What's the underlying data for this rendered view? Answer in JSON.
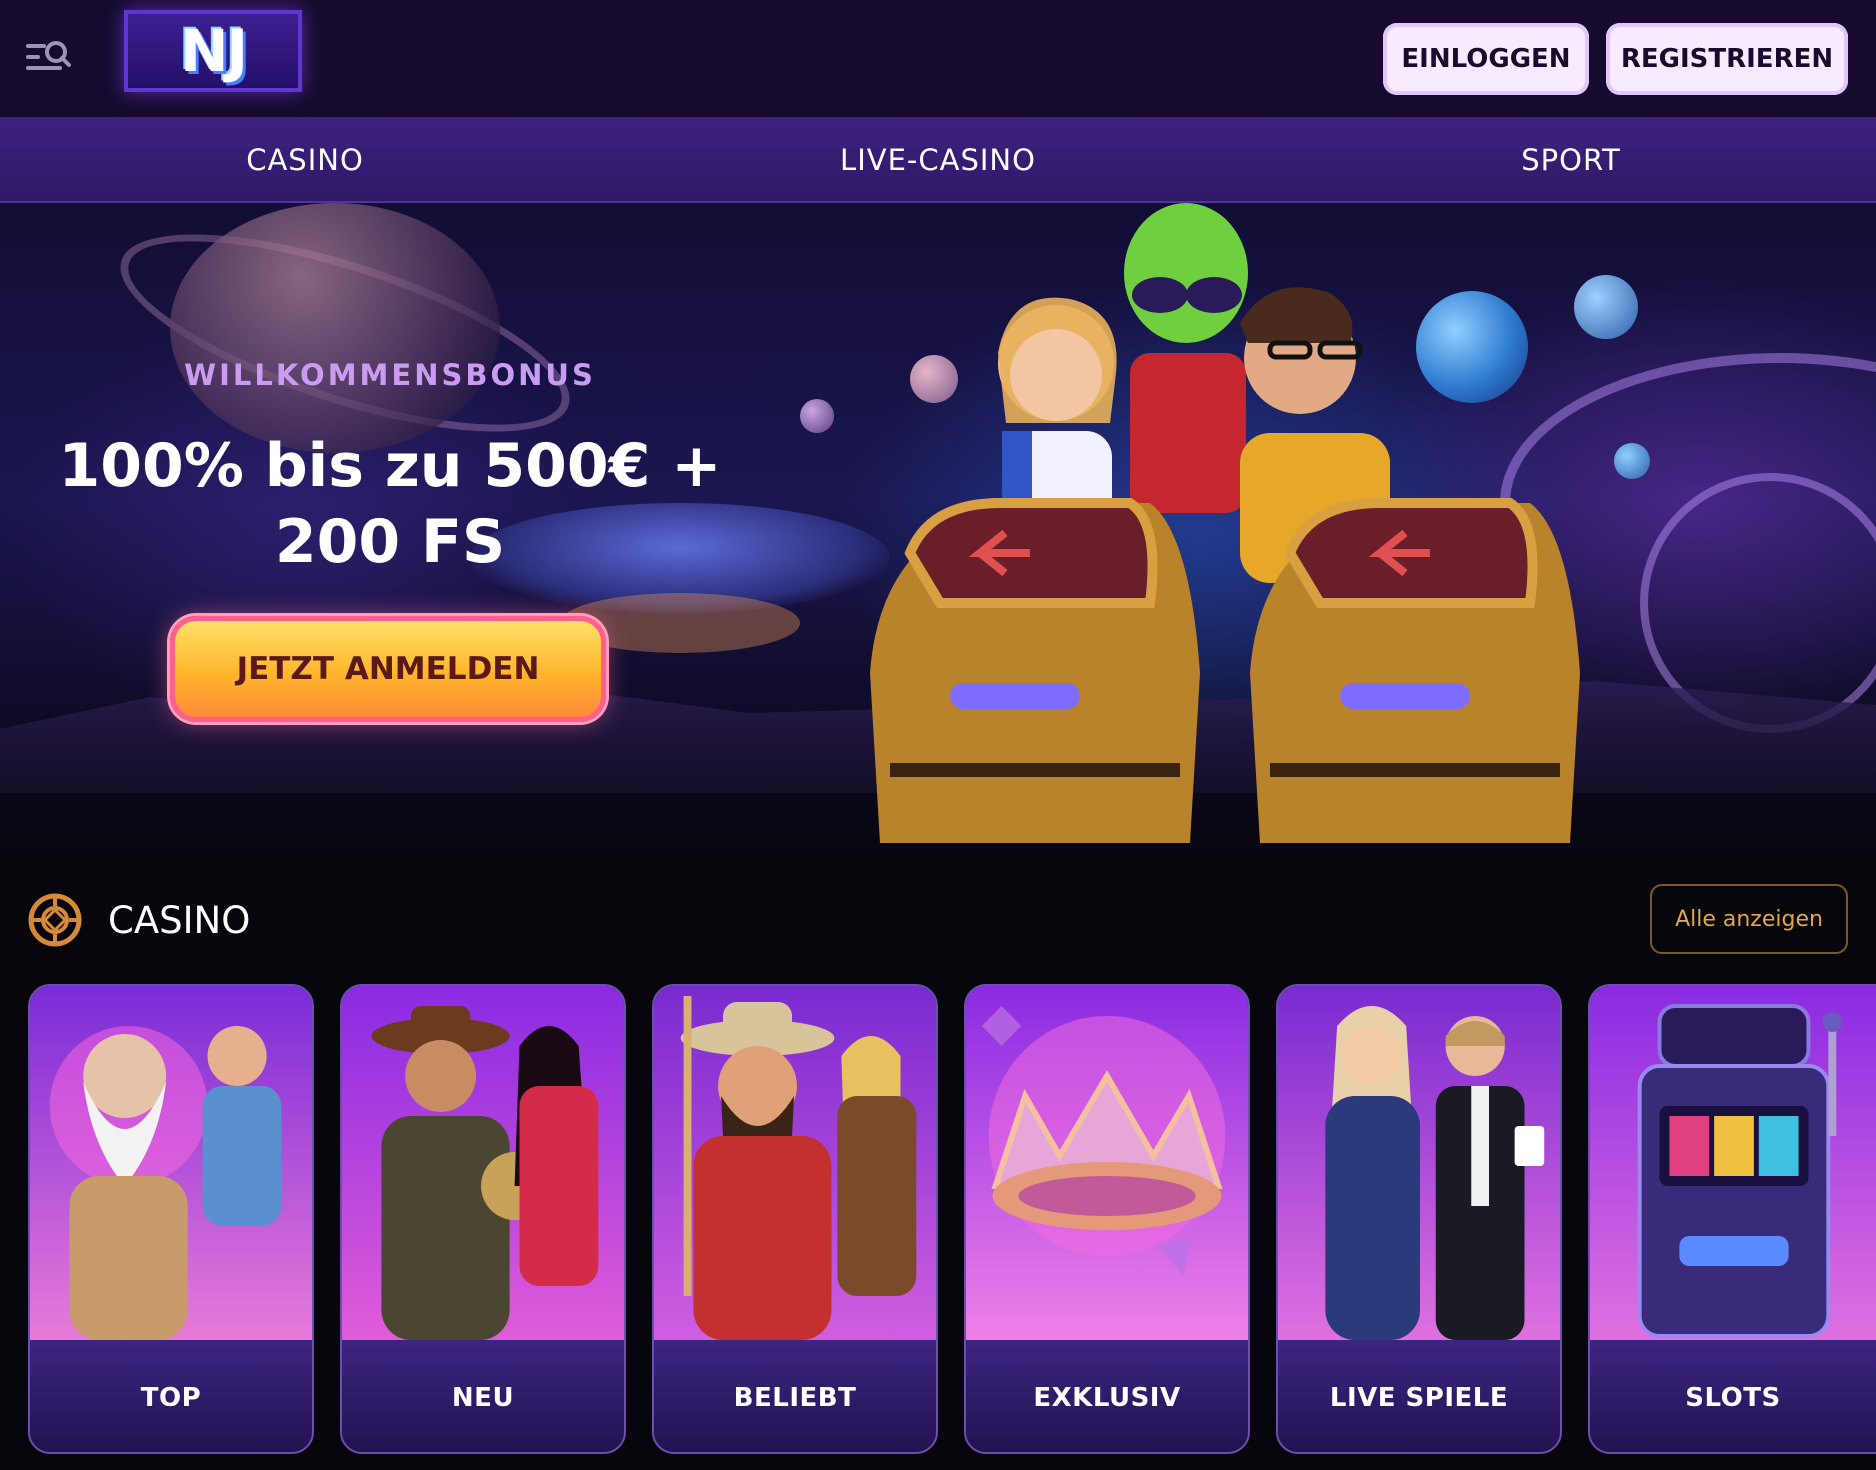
{
  "header": {
    "logo_text": "NJ",
    "login_label": "EINLOGGEN",
    "register_label": "REGISTRIEREN"
  },
  "nav": {
    "items": [
      {
        "label": "CASINO"
      },
      {
        "label": "LIVE-CASINO"
      },
      {
        "label": "SPORT"
      }
    ]
  },
  "hero": {
    "kicker": "WILLKOMMENSBONUS",
    "headline": "100% bis zu 500€ + 200 FS",
    "cta_label": "JETZT ANMELDEN"
  },
  "section": {
    "title": "CASINO",
    "see_all_label": "Alle anzeigen"
  },
  "cards": [
    {
      "label": "TOP"
    },
    {
      "label": "NEU"
    },
    {
      "label": "BELIEBT"
    },
    {
      "label": "EXKLUSIV"
    },
    {
      "label": "LIVE SPIELE"
    },
    {
      "label": "SLOTS"
    }
  ],
  "colors": {
    "header_bg": "#160b2e",
    "nav_bg": "#3d2280",
    "accent_gold": "#e0a647",
    "cta_gradient": "#ffb52b",
    "card_label_bg": "#3b2580"
  },
  "icons": {
    "menu": "menu-search-icon",
    "section": "roulette-chip-icon"
  }
}
